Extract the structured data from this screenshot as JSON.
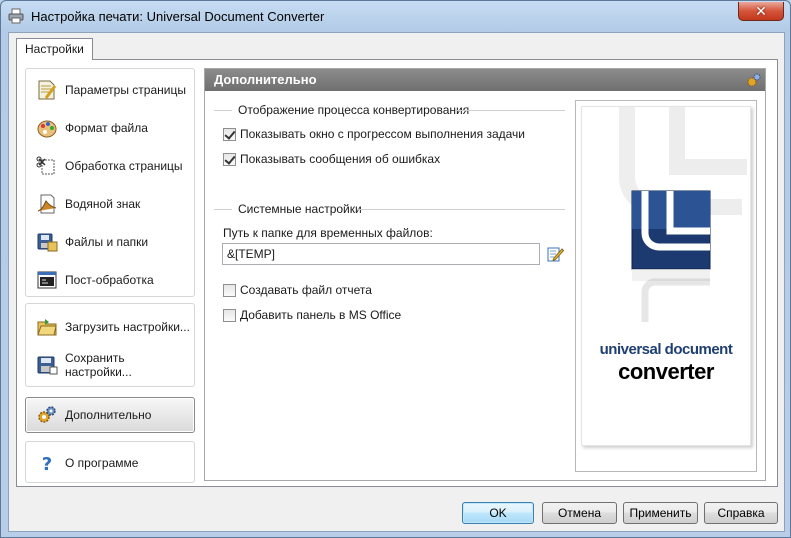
{
  "window": {
    "title": "Настройка печати: Universal Document Converter",
    "close_label": "✕"
  },
  "tab": {
    "label": "Настройки"
  },
  "nav": {
    "group1": [
      {
        "label": "Параметры страницы",
        "icon": "page-setup-icon"
      },
      {
        "label": "Формат файла",
        "icon": "palette-icon"
      },
      {
        "label": "Обработка страницы",
        "icon": "crop-icon"
      },
      {
        "label": "Водяной знак",
        "icon": "watermark-icon"
      },
      {
        "label": "Файлы и папки",
        "icon": "floppy-folder-icon"
      },
      {
        "label": "Пост-обработка",
        "icon": "console-icon"
      }
    ],
    "group2": [
      {
        "label": "Загрузить настройки...",
        "icon": "load-folder-icon"
      },
      {
        "label": "Сохранить настройки...",
        "icon": "save-floppy-icon"
      }
    ],
    "active": {
      "label": "Дополнительно",
      "icon": "gears-icon"
    },
    "about": {
      "label": "О программе",
      "icon": "help-icon"
    }
  },
  "content": {
    "header": "Дополнительно",
    "section1": {
      "title": "Отображение процесса конвертирования",
      "options": [
        {
          "label": "Показывать окно с прогрессом выполнения задачи",
          "checked": true
        },
        {
          "label": "Показывать сообщения об ошибках",
          "checked": true
        }
      ]
    },
    "section2": {
      "title": "Системные настройки",
      "temp_label": "Путь к папке для временных файлов:",
      "temp_value": "&[TEMP]",
      "options": [
        {
          "label": "Создавать файл отчета",
          "checked": false
        },
        {
          "label": "Добавить панель в MS Office",
          "checked": false
        }
      ]
    },
    "logo": {
      "line1": "universal document",
      "line2": "converter"
    }
  },
  "buttons": {
    "ok": "OK",
    "cancel": "Отмена",
    "apply": "Применить",
    "help": "Справка"
  }
}
